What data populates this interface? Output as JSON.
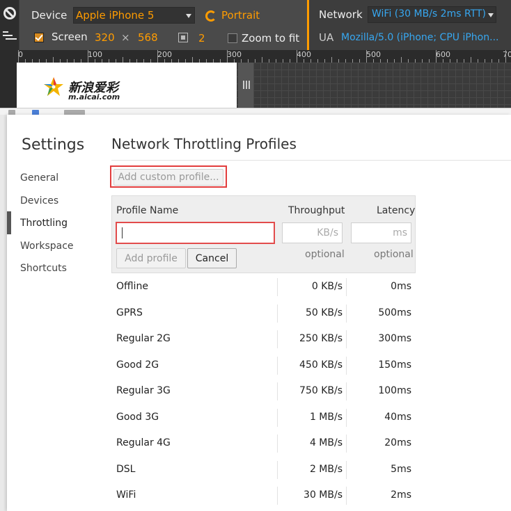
{
  "emulation": {
    "device_label": "Device",
    "device_value": "Apple iPhone 5",
    "orientation": "Portrait",
    "screen_label": "Screen",
    "screen_width": "320",
    "times": "×",
    "screen_height": "568",
    "scale_value": "2",
    "zoom_label": "Zoom to fit",
    "network_label": "Network",
    "network_value": "WiFi (30 MB/s 2ms RTT)",
    "ua_label": "UA",
    "ua_value": "Mozilla/5.0 (iPhone; CPU iPhon..."
  },
  "ruler": {
    "ticks": [
      "0",
      "100",
      "200",
      "300",
      "400",
      "500",
      "600",
      "70"
    ]
  },
  "page": {
    "logo_cn": "新浪爱彩",
    "logo_url": "m.aicai.com"
  },
  "settings": {
    "title": "Settings",
    "nav": [
      "General",
      "Devices",
      "Throttling",
      "Workspace",
      "Shortcuts"
    ],
    "active_nav": "Throttling",
    "section_title": "Network Throttling Profiles",
    "add_custom_label": "Add custom profile...",
    "table": {
      "col_name": "Profile Name",
      "col_throughput": "Throughput",
      "col_latency": "Latency",
      "name_value": "",
      "throughput_placeholder": "KB/s",
      "latency_placeholder": "ms",
      "optional_throughput": "optional",
      "optional_latency": "optional",
      "add_profile_label": "Add profile",
      "cancel_label": "Cancel",
      "rows": [
        {
          "name": "Offline",
          "throughput": "0 KB/s",
          "latency": "0ms"
        },
        {
          "name": "GPRS",
          "throughput": "50 KB/s",
          "latency": "500ms"
        },
        {
          "name": "Regular 2G",
          "throughput": "250 KB/s",
          "latency": "300ms"
        },
        {
          "name": "Good 2G",
          "throughput": "450 KB/s",
          "latency": "150ms"
        },
        {
          "name": "Regular 3G",
          "throughput": "750 KB/s",
          "latency": "100ms"
        },
        {
          "name": "Good 3G",
          "throughput": "1 MB/s",
          "latency": "40ms"
        },
        {
          "name": "Regular 4G",
          "throughput": "4 MB/s",
          "latency": "20ms"
        },
        {
          "name": "DSL",
          "throughput": "2 MB/s",
          "latency": "5ms"
        },
        {
          "name": "WiFi",
          "throughput": "30 MB/s",
          "latency": "2ms"
        }
      ]
    }
  },
  "colors": {
    "accent_orange": "#ff9c00",
    "accent_blue": "#37a7f0",
    "highlight_red": "#e23c3c"
  }
}
